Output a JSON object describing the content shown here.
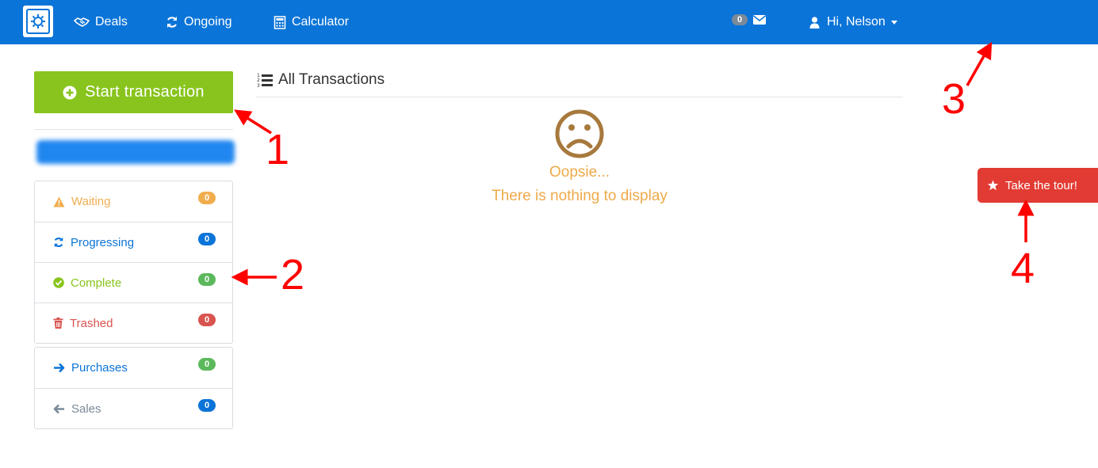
{
  "header": {
    "nav": [
      {
        "label": "Deals",
        "icon": "handshake-icon"
      },
      {
        "label": "Ongoing",
        "icon": "refresh-icon"
      },
      {
        "label": "Calculator",
        "icon": "calculator-icon"
      }
    ],
    "messages_count": "0",
    "user_greeting": "Hi, Nelson"
  },
  "sidebar": {
    "start_label": "Start transaction",
    "status_items": [
      {
        "label": "Waiting",
        "count": "0",
        "color": "#f0ad4e",
        "icon": "warning-icon"
      },
      {
        "label": "Progressing",
        "count": "0",
        "color": "#0b74d8",
        "icon": "refresh-icon"
      },
      {
        "label": "Complete",
        "count": "0",
        "color": "#88c41d",
        "icon": "check-circle-icon"
      },
      {
        "label": "Trashed",
        "count": "0",
        "color": "#d9534f",
        "icon": "trash-icon"
      }
    ],
    "direction_items": [
      {
        "label": "Purchases",
        "count": "0",
        "color": "#0b74d8",
        "icon": "arrow-right-icon"
      },
      {
        "label": "Sales",
        "count": "0",
        "color": "#7b8a98",
        "icon": "arrow-left-icon"
      }
    ]
  },
  "main": {
    "title": "All Transactions",
    "empty_heading": "Oopsie...",
    "empty_message": "There is nothing to display"
  },
  "tour_label": "Take the tour!",
  "annotations": [
    "1",
    "2",
    "3",
    "4"
  ],
  "colors": {
    "brand_blue": "#0b74d8",
    "start_green": "#88c41d",
    "tour_red": "#e23b33",
    "empty_orange": "#eeaa49",
    "annotation_red": "#ff0000"
  }
}
